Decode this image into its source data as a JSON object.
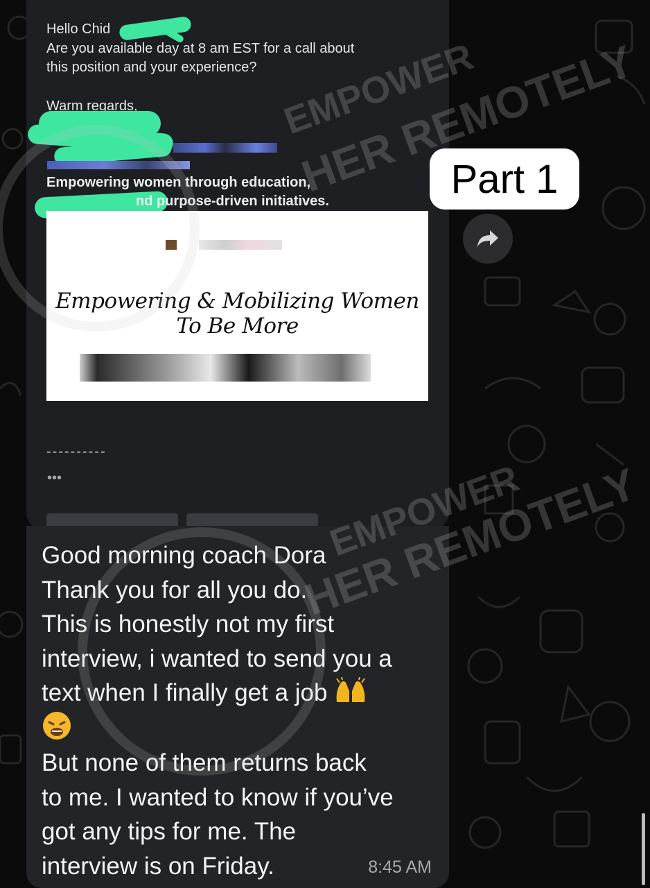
{
  "quoted_email": {
    "greeting": "Hello Chid",
    "line_availability": "Are you available        day at 8 am EST for a call about",
    "line_topic": "this position and your experience?",
    "closing": "Warm regards,",
    "tagline_1": "Empowering women through education,",
    "tagline_2": "nd purpose-driven initiatives.",
    "signature_image_text": "Empowering & Mobilizing Women To Be More",
    "dashes": "----------",
    "ellipsis": "•••"
  },
  "reply_message": {
    "line_1": "Good morning coach Dora",
    "line_2": "Thank you for all you do.",
    "line_3": "This is honestly not my first",
    "line_4": "interview, i wanted to send you a",
    "line_5": "text when I finally get a job",
    "line_6": "But none of them returns back",
    "line_7": "to me. I wanted to know if you’ve",
    "line_8": "got any tips for me. The",
    "line_9": "interview is on Friday.",
    "timestamp": "8:45 AM"
  },
  "overlay": {
    "part_label": "Part 1",
    "watermark_line_1": "EMPOWER",
    "watermark_line_2": "HER REMOTELY"
  },
  "icons": {
    "forward": "forward-arrow-icon",
    "emoji_1": "raising-hands-emoji",
    "emoji_2": "weary-face-emoji"
  },
  "colors": {
    "bubble": "#202124",
    "redaction": "#3ee6a0",
    "label_bg": "#ffffff"
  }
}
